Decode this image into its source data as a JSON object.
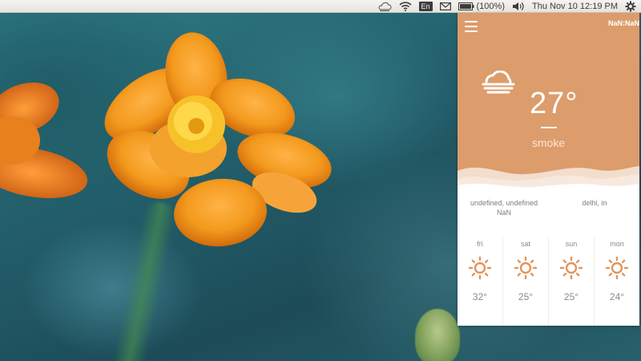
{
  "topbar": {
    "icons": [
      "weather-cloud-icon",
      "wifi-icon",
      "keyboard-layout-icon",
      "mail-icon",
      "battery-icon",
      "volume-icon",
      "system-gear-icon"
    ],
    "language": "En",
    "battery_text": "(100%)",
    "datetime": "Thu Nov 10 12:19 PM"
  },
  "widget": {
    "menu_icon": "hamburger-menu-icon",
    "clock": "NaN:NaN",
    "condition_icon": "cloud-fog-icon",
    "temperature": "27°",
    "description": "smoke",
    "colors": {
      "accent": "#dd9c6c",
      "card_bg": "#ffffff",
      "icon": "#e0955f",
      "text_muted": "#8a8a8a"
    },
    "location_left_line1": "undefined, undefined",
    "location_left_line2": "NaN",
    "location_right": "delhi, in",
    "forecast": [
      {
        "day": "fri",
        "icon": "sun-icon",
        "temp": "32°"
      },
      {
        "day": "sat",
        "icon": "sun-icon",
        "temp": "25°"
      },
      {
        "day": "sun",
        "icon": "sun-icon",
        "temp": "25°"
      },
      {
        "day": "mon",
        "icon": "sun-icon",
        "temp": "24°"
      }
    ]
  }
}
